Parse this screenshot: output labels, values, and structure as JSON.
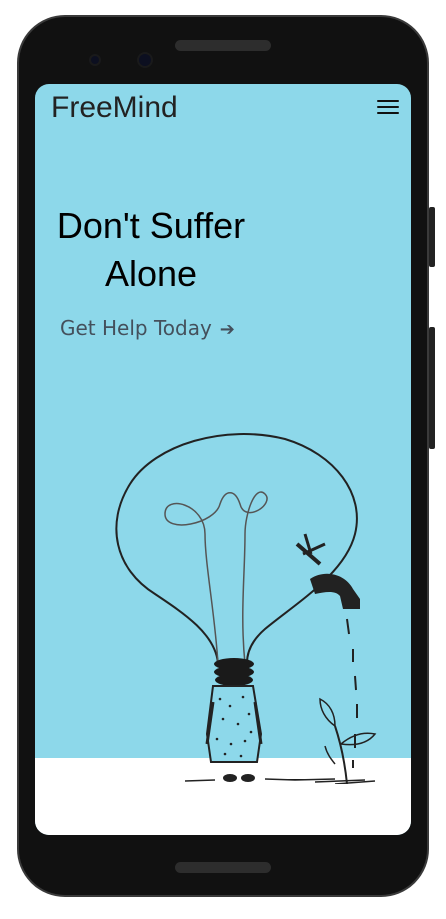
{
  "app": {
    "brand": "FreeMind"
  },
  "hero": {
    "title_line1": "Don't Suffer",
    "title_line2": "Alone",
    "cta_label": "Get Help Today",
    "cta_arrow": "➔"
  },
  "colors": {
    "screen_bg": "#8dd8ea",
    "ground": "#ffffff",
    "frame": "#111111"
  },
  "icons": [
    "hamburger-menu-icon",
    "lightbulb-illustration",
    "faucet-illustration",
    "plant-illustration"
  ]
}
